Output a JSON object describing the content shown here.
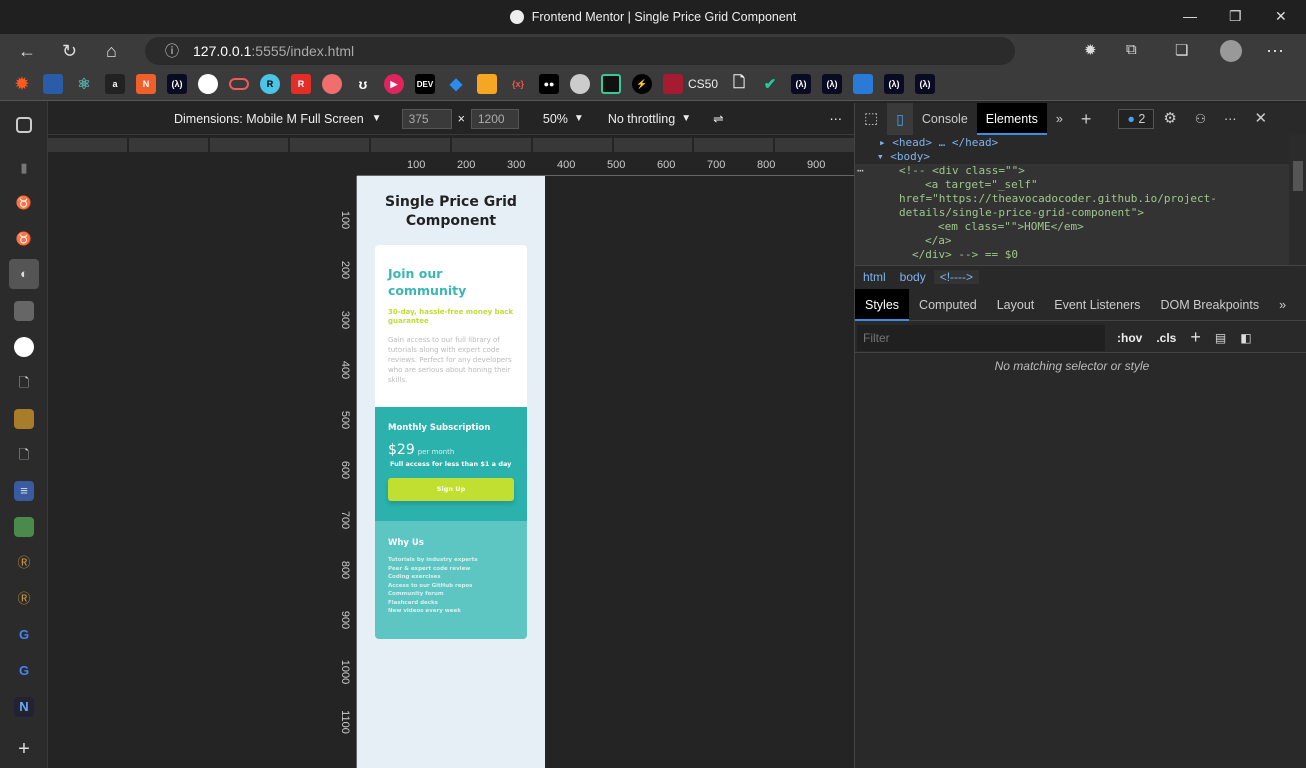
{
  "window": {
    "title": "Frontend Mentor | Single Price Grid Component",
    "minimize": "—",
    "maximize": "❐",
    "close": "✕"
  },
  "browser": {
    "url_host": "127.0.0.1",
    "url_path": ":5555/index.html",
    "bookmarks_text": [
      "CS50"
    ]
  },
  "device_toolbar": {
    "dimensions": "Dimensions: Mobile M Full Screen",
    "width": "375",
    "height": "1200",
    "times": "×",
    "zoom": "50%",
    "throttling": "No throttling"
  },
  "rulers": {
    "horizontal": [
      "100",
      "200",
      "300",
      "400",
      "500",
      "600",
      "700",
      "800",
      "900"
    ],
    "vertical": [
      "100",
      "200",
      "300",
      "400",
      "500",
      "600",
      "700",
      "800",
      "900",
      "1000",
      "1100"
    ]
  },
  "page": {
    "title": "Single Price Grid Component",
    "community": {
      "heading": "Join our community",
      "subheading": "30-day, hassle-free money back guarantee",
      "text": "Gain access to our full library of tutorials along with expert code reviews. Perfect for any developers who are serious about honing their skills."
    },
    "subscription": {
      "heading": "Monthly Subscription",
      "price": "$29",
      "period": "per month",
      "note": "Full access for less than $1 a day",
      "button": "Sign Up"
    },
    "why": {
      "heading": "Why Us",
      "items": [
        "Tutorials by industry experts",
        "Peer & expert code review",
        "Coding exercises",
        "Access to our GitHub repos",
        "Community forum",
        "Flashcard decks",
        "New videos every week"
      ]
    },
    "colors": {
      "teal": "#2bb2ad",
      "light_teal": "#5dc5c2",
      "lime": "#c1df30",
      "bg": "#e7eff6"
    }
  },
  "devtools": {
    "tabs": [
      "Console",
      "Elements"
    ],
    "active_tab": "Elements",
    "issues_count": "2",
    "dom": [
      "<head> … </head>",
      "<body>",
      "<!-- <div class=\"\">",
      "<a target=\"_self\"",
      "href=\"https://theavocadocoder.github.io/project-",
      "details/single-price-grid-component\">",
      "<em class=\"\">HOME</em>",
      "</a>",
      "</div> --> == $0"
    ],
    "breadcrumbs": [
      "html",
      "body",
      "<!---->"
    ],
    "style_tabs": [
      "Styles",
      "Computed",
      "Layout",
      "Event Listeners",
      "DOM Breakpoints"
    ],
    "filter_placeholder": "Filter",
    "hov": ":hov",
    "cls": ".cls",
    "no_match": "No matching selector or style"
  }
}
